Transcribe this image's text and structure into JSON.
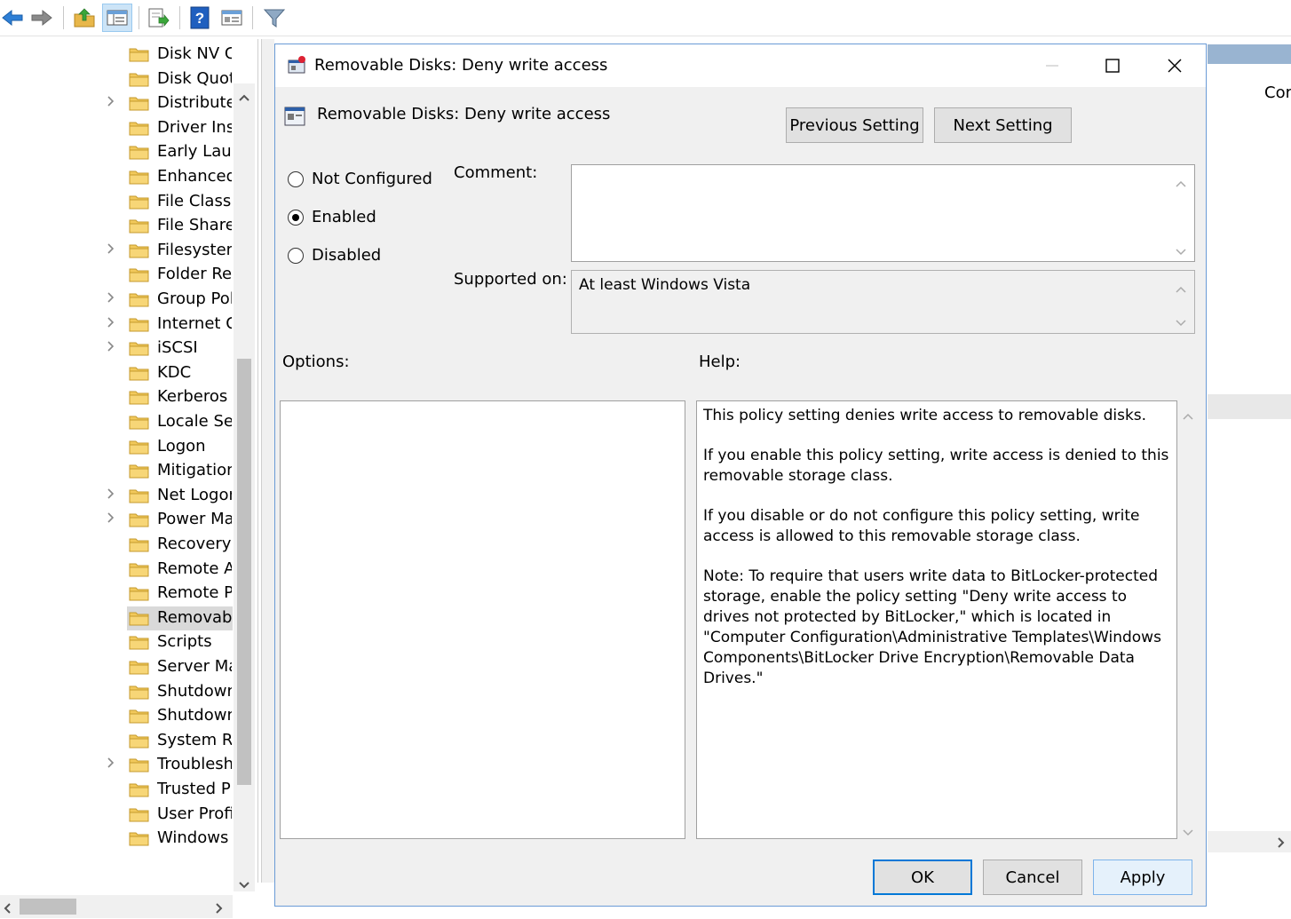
{
  "toolbar": {
    "buttons": [
      "back-arrow-icon",
      "forward-arrow-icon",
      "up-folder-icon",
      "show-hide-tree-icon",
      "export-list-icon",
      "help-icon",
      "properties-view-icon",
      "filter-icon"
    ]
  },
  "tree": {
    "items": [
      {
        "label": "Disk NV Ca",
        "expandable": false
      },
      {
        "label": "Disk Quota",
        "expandable": false
      },
      {
        "label": "Distributed",
        "expandable": true
      },
      {
        "label": "Driver Inst",
        "expandable": false
      },
      {
        "label": "Early Laun",
        "expandable": false
      },
      {
        "label": "Enhanced",
        "expandable": false
      },
      {
        "label": "File Classif",
        "expandable": false
      },
      {
        "label": "File Share",
        "expandable": false
      },
      {
        "label": "Filesystem",
        "expandable": true
      },
      {
        "label": "Folder Red",
        "expandable": false
      },
      {
        "label": "Group Pol",
        "expandable": true
      },
      {
        "label": "Internet Co",
        "expandable": true
      },
      {
        "label": "iSCSI",
        "expandable": true
      },
      {
        "label": "KDC",
        "expandable": false
      },
      {
        "label": "Kerberos",
        "expandable": false
      },
      {
        "label": "Locale Ser",
        "expandable": false
      },
      {
        "label": "Logon",
        "expandable": false
      },
      {
        "label": "Mitigation",
        "expandable": false
      },
      {
        "label": "Net Logon",
        "expandable": true
      },
      {
        "label": "Power Ma",
        "expandable": true
      },
      {
        "label": "Recovery",
        "expandable": false
      },
      {
        "label": "Remote As",
        "expandable": false
      },
      {
        "label": "Remote Pr",
        "expandable": false
      },
      {
        "label": "Removabl",
        "expandable": false,
        "selected": true
      },
      {
        "label": "Scripts",
        "expandable": false
      },
      {
        "label": "Server Mar",
        "expandable": false
      },
      {
        "label": "Shutdown",
        "expandable": false
      },
      {
        "label": "Shutdown",
        "expandable": false
      },
      {
        "label": "System Re",
        "expandable": false
      },
      {
        "label": "Troublesh",
        "expandable": true
      },
      {
        "label": "Trusted Pl",
        "expandable": false
      },
      {
        "label": "User Profil",
        "expandable": false
      },
      {
        "label": "Windows I",
        "expandable": false
      }
    ]
  },
  "background": {
    "right_column_header": "Cor"
  },
  "dialog": {
    "title": "Removable Disks: Deny write access",
    "setting_name": "Removable Disks: Deny write access",
    "previous_label": "Previous Setting",
    "next_label": "Next Setting",
    "radio_not_configured": "Not Configured",
    "radio_enabled": "Enabled",
    "radio_disabled": "Disabled",
    "selected_state": "Enabled",
    "comment_label": "Comment:",
    "comment_value": "",
    "supported_label": "Supported on:",
    "supported_value": "At least Windows Vista",
    "options_label": "Options:",
    "help_label": "Help:",
    "help_paragraphs": [
      "This policy setting denies write access to removable disks.",
      "If you enable this policy setting, write access is denied to this removable storage class.",
      "If you disable or do not configure this policy setting, write access is allowed to this removable storage class.",
      "Note: To require that users write data to BitLocker-protected storage, enable the policy setting \"Deny write access to drives not protected by BitLocker,\" which is located in \"Computer Configuration\\Administrative Templates\\Windows Components\\BitLocker Drive Encryption\\Removable Data Drives.\""
    ],
    "ok_label": "OK",
    "cancel_label": "Cancel",
    "apply_label": "Apply"
  },
  "colors": {
    "accent": "#0078d7",
    "dialog_bg": "#f0f0f0",
    "folder": "#f2c95c"
  }
}
